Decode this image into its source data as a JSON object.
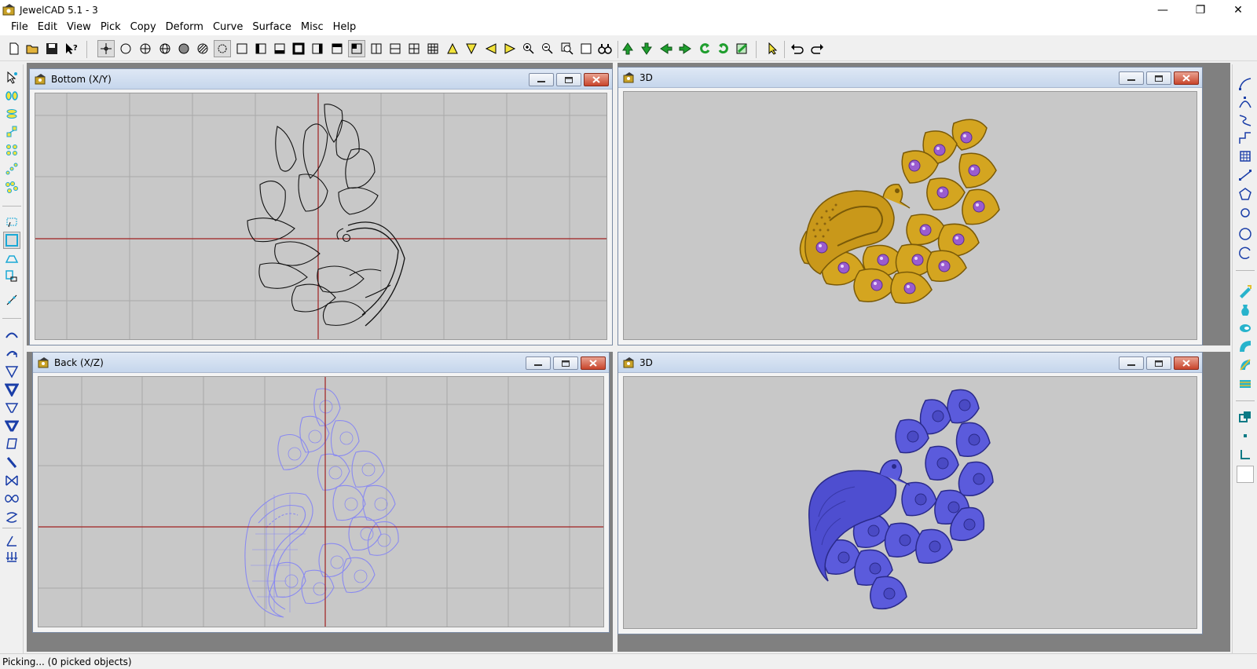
{
  "app": {
    "title": "JewelCAD 5.1 - 3"
  },
  "window_controls": {
    "minimize": "—",
    "restore": "❐",
    "close": "✕"
  },
  "menu": [
    "File",
    "Edit",
    "View",
    "Pick",
    "Copy",
    "Deform",
    "Curve",
    "Surface",
    "Misc",
    "Help"
  ],
  "viewports": [
    {
      "title": "Bottom (X/Y)"
    },
    {
      "title": "3D"
    },
    {
      "title": "Back (X/Z)"
    },
    {
      "title": "3D"
    }
  ],
  "status": {
    "text": "Picking... (0 picked objects)"
  },
  "colors": {
    "gold": "#d4a520",
    "gem": "#9a5ccf",
    "blue_model": "#5b5bdc",
    "wireframe": "#8a8af0",
    "axis_red": "#a02020",
    "viewport_bg": "#c8c8c8"
  }
}
